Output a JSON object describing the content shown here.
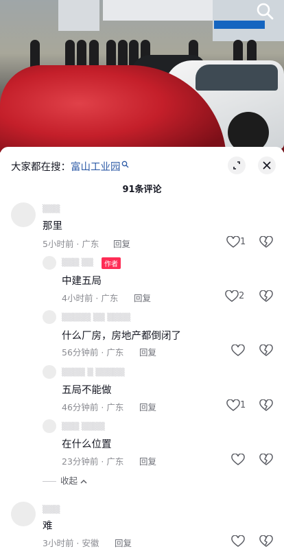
{
  "header": {
    "prefix": "大家都在搜：",
    "search_link": "富山工业园",
    "comment_count": "91条评论"
  },
  "comments": [
    {
      "text": "那里",
      "time_location": "5小时前 · 广东",
      "reply_label": "回复",
      "likes": "1"
    },
    {
      "text": "中建五局",
      "time_location": "4小时前 · 广东",
      "reply_label": "回复",
      "likes": "2",
      "author_badge": "作者"
    },
    {
      "text": "什么厂房，房地产都倒闭了",
      "time_location": "56分钟前 · 广东",
      "reply_label": "回复"
    },
    {
      "text": "五局不能做",
      "time_location": "46分钟前 · 广东",
      "reply_label": "回复",
      "likes": "1"
    },
    {
      "text": "在什么位置",
      "time_location": "23分钟前 · 广东",
      "reply_label": "回复"
    },
    {
      "text": "难",
      "time_location": "3小时前 · 安徽",
      "reply_label": "回复"
    }
  ],
  "collapse_label": "收起",
  "colors": {
    "accent_link": "#2c5aa6",
    "author_badge": "#fe2c55"
  },
  "icons": [
    "search-icon",
    "expand-icon",
    "close-icon",
    "heart-icon",
    "broken-heart-icon",
    "chevron-up-icon"
  ]
}
